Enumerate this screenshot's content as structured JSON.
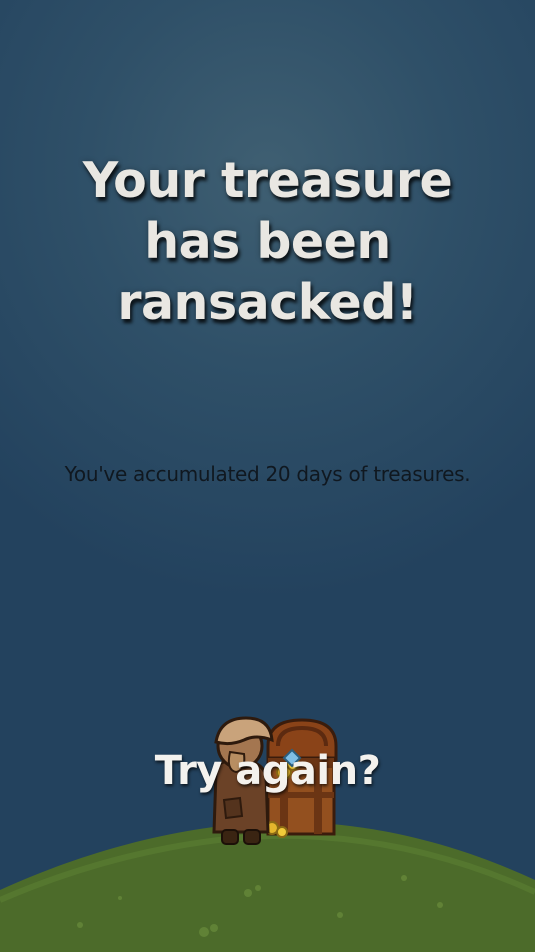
{
  "screen": {
    "title_lines": [
      "Your treasure",
      "has been",
      "ransacked!"
    ],
    "message": "You've accumulated 20 days of treasures.",
    "retry_label": "Try again?"
  },
  "scene": {
    "background_top": "#3f5f72",
    "background_bottom": "#23425e",
    "hill_color": "#4c6b2a",
    "character": "hooded-adventurer",
    "prop": "open-treasure-chest"
  }
}
